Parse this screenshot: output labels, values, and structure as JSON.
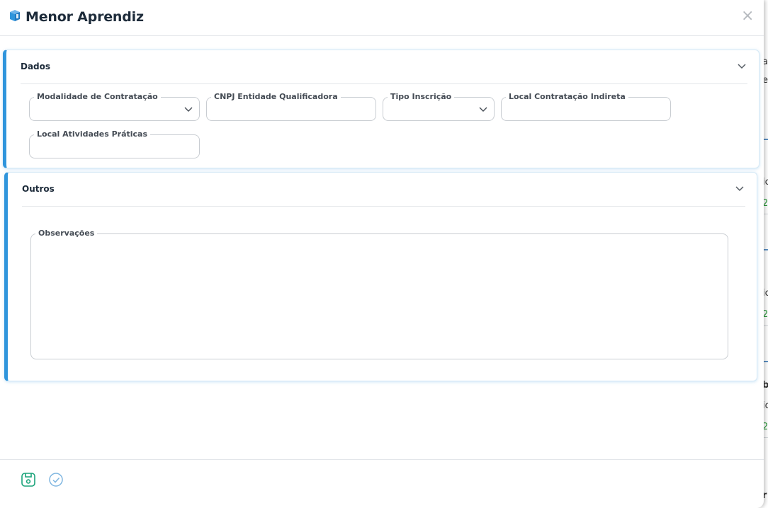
{
  "modal": {
    "title": "Menor Aprendiz",
    "close_label": "×"
  },
  "section_dados": {
    "title": "Dados",
    "fields": {
      "modalidade": {
        "label": "Modalidade de Contratação",
        "value": ""
      },
      "cnpj": {
        "label": "CNPJ Entidade Qualificadora",
        "value": ""
      },
      "tipo_inscricao": {
        "label": "Tipo Inscrição",
        "value": ""
      },
      "local_contratacao": {
        "label": "Local Contratação Indireta",
        "value": ""
      },
      "local_atividades": {
        "label": "Local Atividades Práticas",
        "value": ""
      }
    }
  },
  "section_outros": {
    "title": "Outros",
    "fields": {
      "observacoes": {
        "label": "Observações",
        "value": ""
      }
    }
  },
  "colors": {
    "accent": "#2f95dc",
    "save": "#1aa37a",
    "confirm": "#7fb6e0"
  },
  "icons": {
    "title": "book-cube-icon",
    "save": "save-icon",
    "confirm": "check-circle-icon"
  }
}
